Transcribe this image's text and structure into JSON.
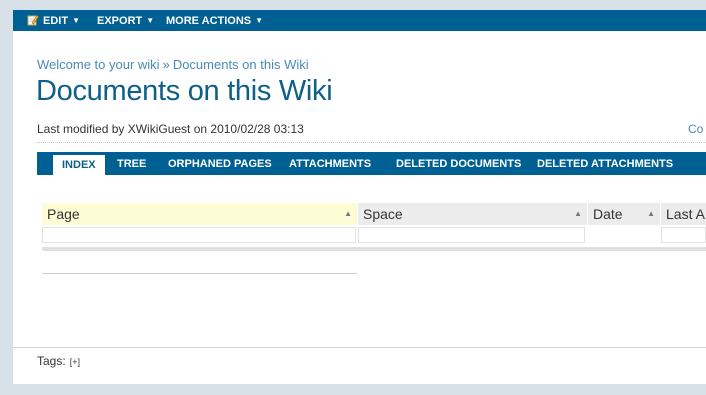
{
  "menu": {
    "edit": "EDIT",
    "export": "EXPORT",
    "more_actions": "MORE ACTIONS",
    "caret": "▼"
  },
  "breadcrumb": {
    "home": "Welcome to your wiki",
    "separator": "»",
    "current": "Documents on this Wiki"
  },
  "page": {
    "title": "Documents on this Wiki",
    "last_modified": "Last modified by XWikiGuest on 2010/02/28 03:13",
    "right_link": "Co"
  },
  "tabs": [
    "INDEX",
    "TREE",
    "ORPHANED PAGES",
    "ATTACHMENTS",
    "DELETED DOCUMENTS",
    "DELETED ATTACHMENTS"
  ],
  "grid": {
    "columns": [
      "Page",
      "Space",
      "Date",
      "Last A"
    ],
    "sort_icon": "▲"
  },
  "tags": {
    "label": "Tags:",
    "add": "[+]"
  },
  "colors": {
    "brand_blue": "#006094",
    "link_blue": "#4a8bb5",
    "sorted_header": "#fdfcd5"
  },
  "icons": {
    "edit": "pencil-icon"
  }
}
